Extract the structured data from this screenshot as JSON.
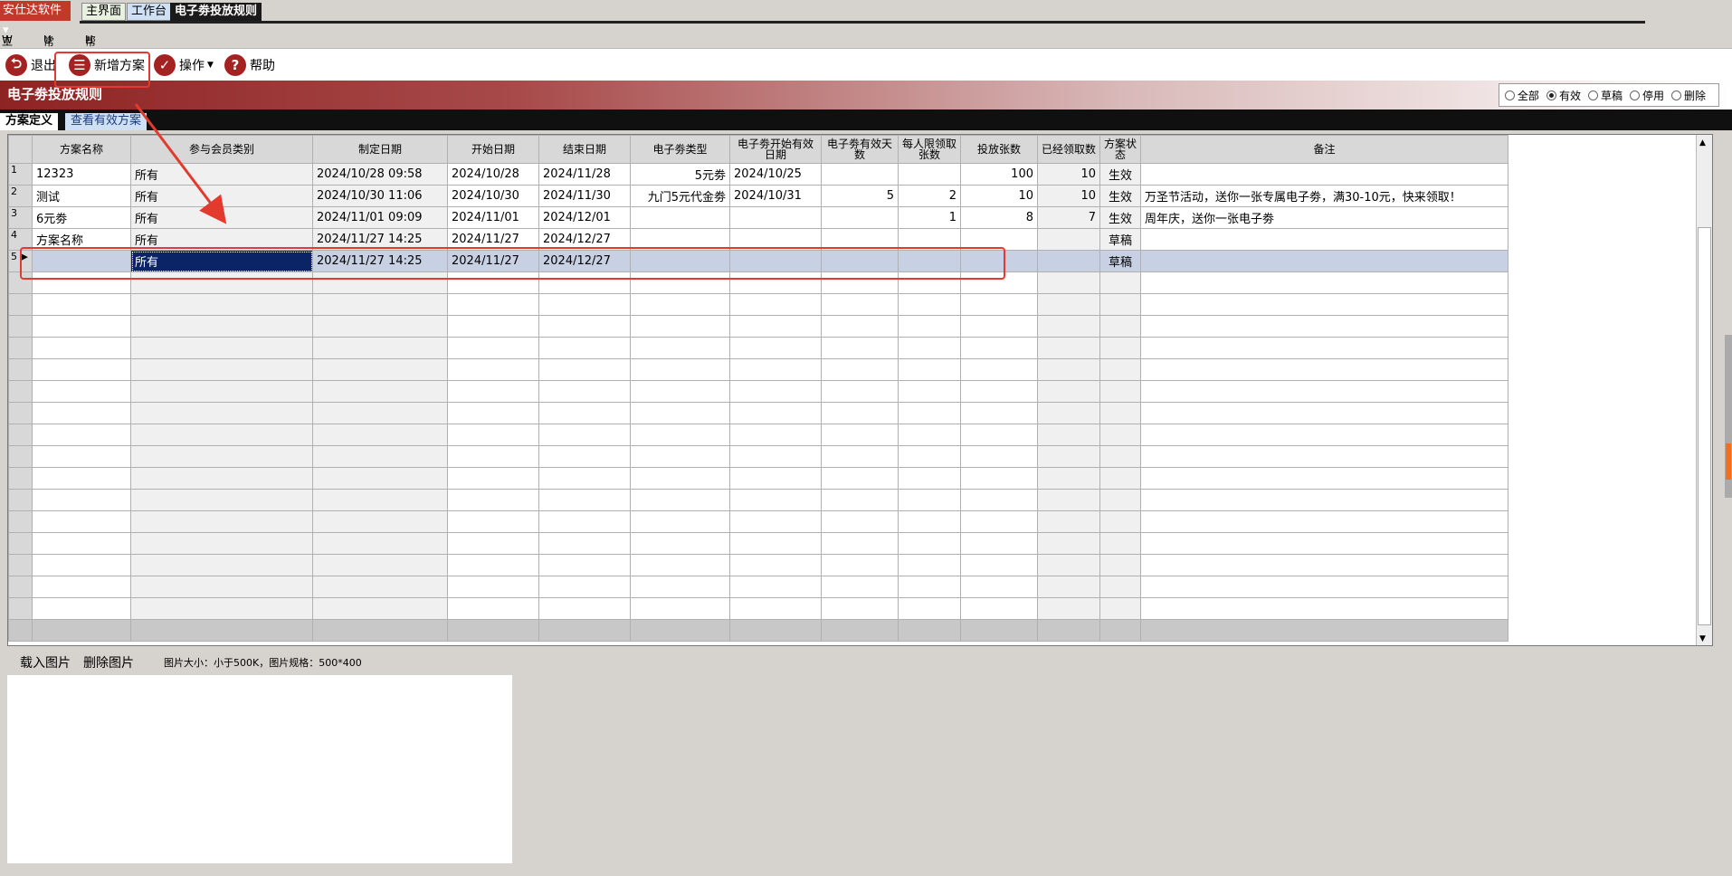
{
  "tabbar": {
    "brand": "安仕达软件",
    "tabs": [
      "主界面",
      "工作台",
      "电子劵投放规则"
    ]
  },
  "menu": [
    {
      "key": "W",
      "label": "工作"
    },
    {
      "key": "U",
      "label": "常用"
    },
    {
      "key": "H",
      "label": "帮助"
    }
  ],
  "toolbar": {
    "exit": "退出",
    "add": "新增方案",
    "ops": "操作",
    "help": "帮助"
  },
  "banner": {
    "title": "电子劵投放规则"
  },
  "filters": {
    "options": [
      "全部",
      "有效",
      "草稿",
      "停用",
      "删除"
    ],
    "selected": "有效"
  },
  "panel_tabs": [
    "方案定义",
    "查看有效方案"
  ],
  "table": {
    "columns": [
      "方案名称",
      "参与会员类别",
      "制定日期",
      "开始日期",
      "结束日期",
      "电子劵类型",
      "电子劵开始有效日期",
      "电子劵有效天数",
      "每人限领取张数",
      "投放张数",
      "已经领取数",
      "方案状态",
      "备注"
    ],
    "rows": [
      {
        "no": "1",
        "c": [
          "12323",
          "所有",
          "2024/10/28 09:58",
          "2024/10/28",
          "2024/11/28",
          "5元劵",
          "2024/10/25",
          "",
          "",
          "100",
          "10",
          "生效",
          ""
        ]
      },
      {
        "no": "2",
        "c": [
          "测试",
          "所有",
          "2024/10/30 11:06",
          "2024/10/30",
          "2024/11/30",
          "九门5元代金劵",
          "2024/10/31",
          "5",
          "2",
          "10",
          "10",
          "生效",
          "万圣节活动，送你一张专属电子劵，满30-10元，快来领取！"
        ]
      },
      {
        "no": "3",
        "c": [
          "6元劵",
          "所有",
          "2024/11/01 09:09",
          "2024/11/01",
          "2024/12/01",
          "",
          "",
          "",
          "1",
          "8",
          "7",
          "生效",
          "周年庆，送你一张电子劵"
        ]
      },
      {
        "no": "4",
        "c": [
          "方案名称",
          "所有",
          "2024/11/27 14:25",
          "2024/11/27",
          "2024/12/27",
          "",
          "",
          "",
          "",
          "",
          "",
          "草稿",
          ""
        ]
      },
      {
        "no": "5",
        "c": [
          "",
          "所有",
          "2024/11/27 14:25",
          "2024/11/27",
          "2024/12/27",
          "",
          "",
          "",
          "",
          "",
          "",
          "草稿",
          ""
        ]
      }
    ]
  },
  "imagebar": {
    "load": "载入图片",
    "delete": "删除图片",
    "hint": "图片大小：小于500K，图片规格：500*400"
  }
}
